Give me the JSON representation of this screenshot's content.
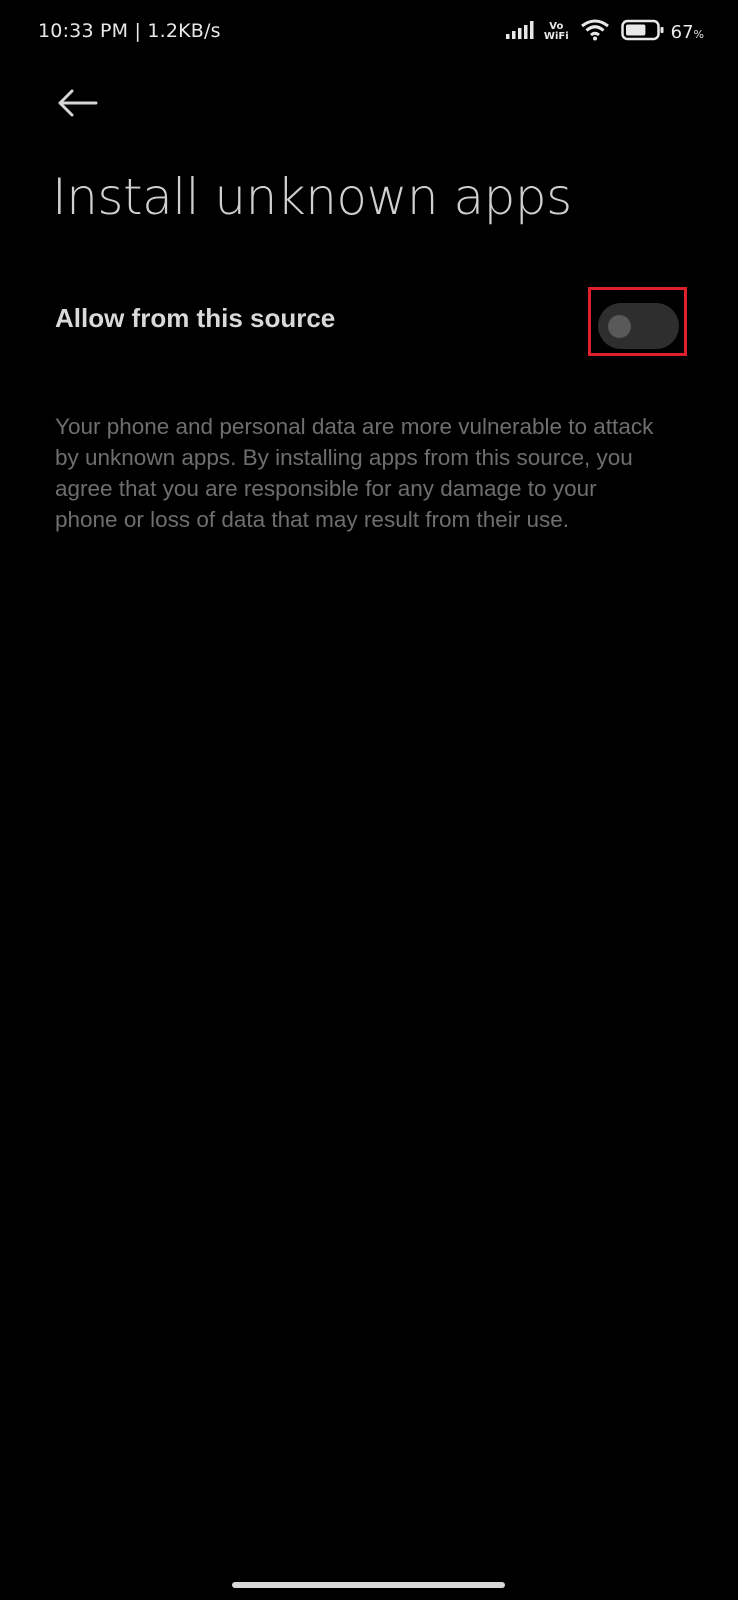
{
  "status_bar": {
    "time_speed": "10:33 PM | 1.2KB/s",
    "vowifi_top": "Vo",
    "vowifi_bottom": "WiFi",
    "battery_value": "67",
    "battery_unit": "%",
    "battery_level": 0.67,
    "icons": [
      "signal-icon",
      "vowifi-icon",
      "wifi-icon",
      "battery-icon"
    ]
  },
  "header": {
    "back_icon": "back-arrow-icon",
    "title": "Install unknown apps"
  },
  "setting": {
    "label": "Allow from this source",
    "enabled": false
  },
  "warning": {
    "text": "Your phone and personal data are more vulnerable to attack by unknown apps. By installing apps from this source, you agree that you are responsible for any damage to your phone or loss of data that may result from their use."
  },
  "colors": {
    "background": "#000000",
    "highlight": "#e0202a",
    "toggle_track": "#2e2e2e",
    "toggle_thumb": "#595959"
  }
}
